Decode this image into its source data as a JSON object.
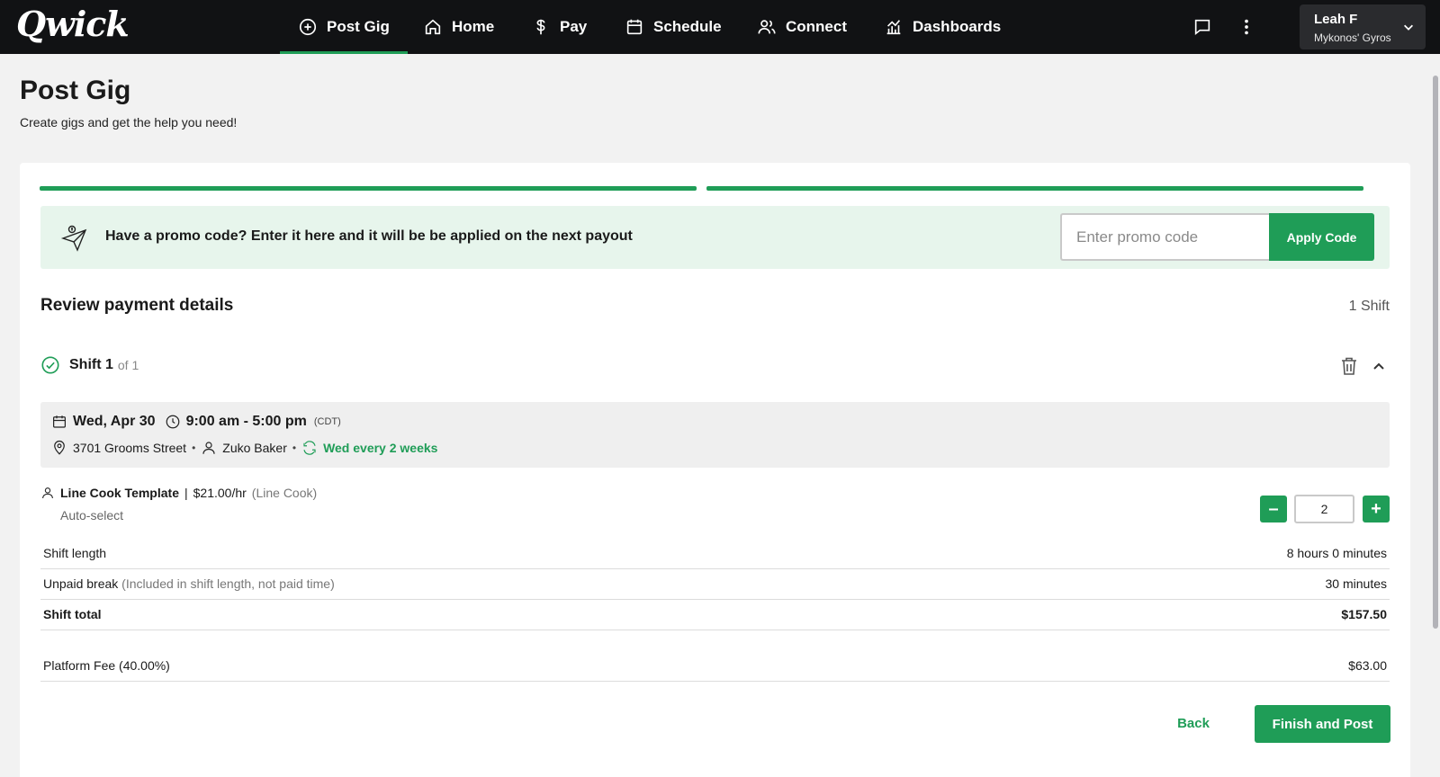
{
  "app": {
    "logo": "Qwick"
  },
  "nav": {
    "post_gig": "Post Gig",
    "home": "Home",
    "pay": "Pay",
    "schedule": "Schedule",
    "connect": "Connect",
    "dashboards": "Dashboards"
  },
  "user": {
    "name": "Leah F",
    "org": "Mykonos' Gyros"
  },
  "page": {
    "title": "Post Gig",
    "subtitle": "Create gigs and get the help you need!"
  },
  "promo": {
    "text": "Have a promo code? Enter it here and it will be be applied on the next payout",
    "placeholder": "Enter promo code",
    "button": "Apply Code"
  },
  "review": {
    "title": "Review payment details",
    "shift_count": "1 Shift"
  },
  "shift": {
    "label": "Shift 1",
    "of": "of 1",
    "date": "Wed, Apr 30",
    "time": "9:00 am - 5:00 pm",
    "tz": "(CDT)",
    "address": "3701 Grooms Street",
    "contact": "Zuko Baker",
    "recurrence": "Wed every 2 weeks"
  },
  "role": {
    "name": "Line Cook Template",
    "separator": "|",
    "rate": "$21.00/hr",
    "type": "(Line Cook)",
    "auto": "Auto-select",
    "quantity": "2",
    "minus": "–",
    "plus": "+"
  },
  "summary": {
    "shift_length_label": "Shift length",
    "shift_length_value": "8 hours 0 minutes",
    "unpaid_break_label": "Unpaid break",
    "unpaid_break_note": "(Included in shift length, not paid time)",
    "unpaid_break_value": "30 minutes",
    "shift_total_label": "Shift total",
    "shift_total_value": "$157.50",
    "platform_fee_label": "Platform Fee (40.00%)",
    "platform_fee_value": "$63.00"
  },
  "actions": {
    "back": "Back",
    "finish": "Finish and Post"
  },
  "colors": {
    "brand_green": "#1f9d57",
    "topbar": "#111214",
    "promo_bg": "#e7f5ec"
  },
  "progress": {
    "steps_total": 2,
    "steps_complete": 2
  }
}
